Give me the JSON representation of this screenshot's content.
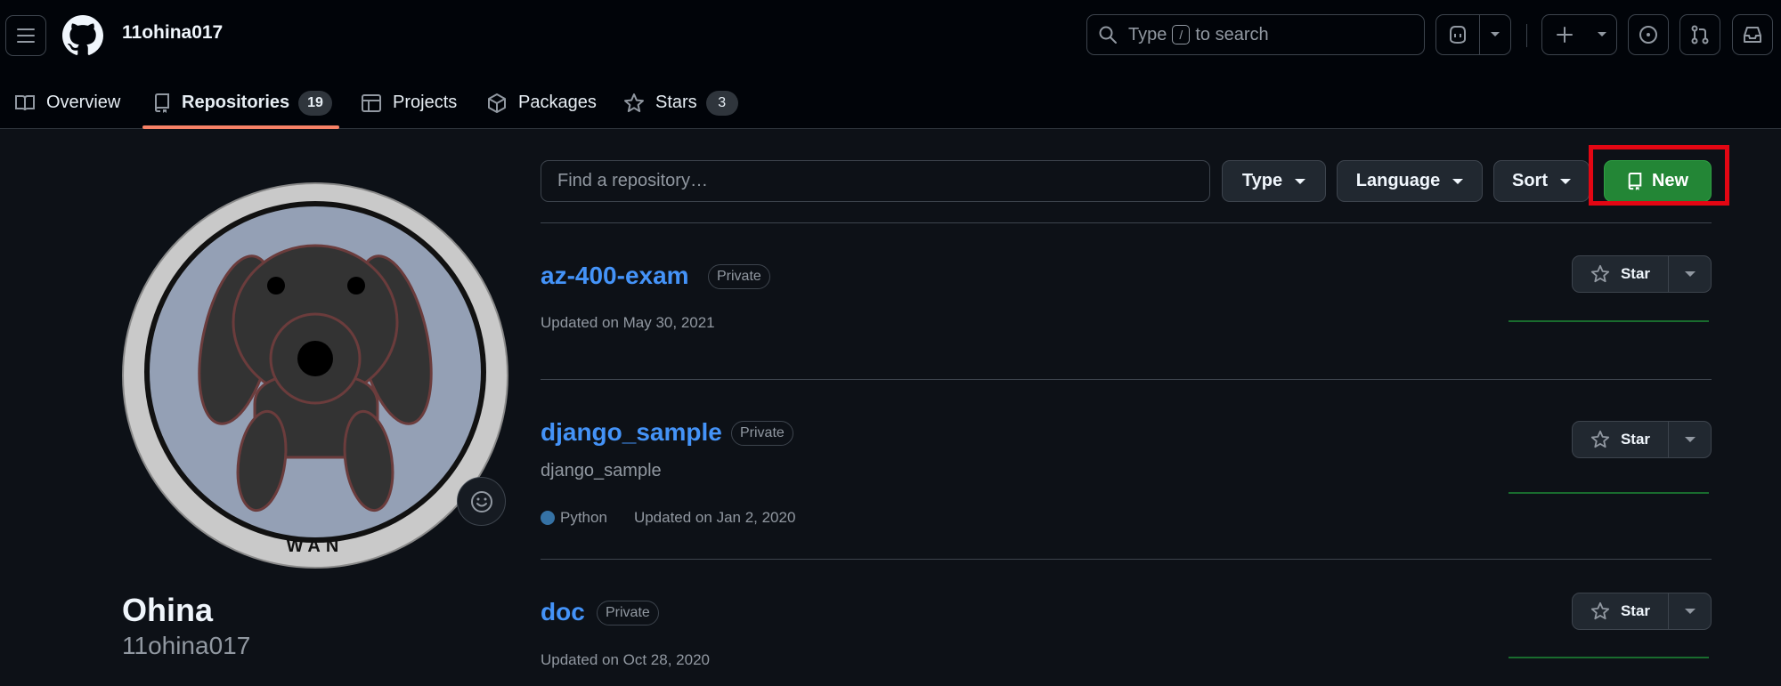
{
  "header": {
    "username": "11ohina017",
    "search": {
      "prefix": "Type",
      "key": "/",
      "suffix": "to search"
    }
  },
  "tabs": [
    {
      "label": "Overview"
    },
    {
      "label": "Repositories",
      "count": "19"
    },
    {
      "label": "Projects"
    },
    {
      "label": "Packages"
    },
    {
      "label": "Stars",
      "count": "3"
    }
  ],
  "profile": {
    "name": "Ohina",
    "login": "11ohina017",
    "avatar_text": "WAN"
  },
  "filters": {
    "find_placeholder": "Find a repository…",
    "type_label": "Type",
    "language_label": "Language",
    "sort_label": "Sort",
    "new_label": "New"
  },
  "repos": [
    {
      "name": "az-400-exam",
      "visibility": "Private",
      "description": "",
      "language": "",
      "updated": "Updated on May 30, 2021",
      "star_label": "Star"
    },
    {
      "name": "django_sample",
      "visibility": "Private",
      "description": "django_sample",
      "language": "Python",
      "updated": "Updated on Jan 2, 2020",
      "star_label": "Star"
    },
    {
      "name": "doc",
      "visibility": "Private",
      "description": "",
      "language": "",
      "updated": "Updated on Oct 28, 2020",
      "star_label": "Star"
    }
  ],
  "colors": {
    "accent_link": "#4493f8",
    "new_button": "#238636",
    "tab_underline": "#f78166",
    "highlight": "#e30613",
    "python": "#3572A5"
  }
}
